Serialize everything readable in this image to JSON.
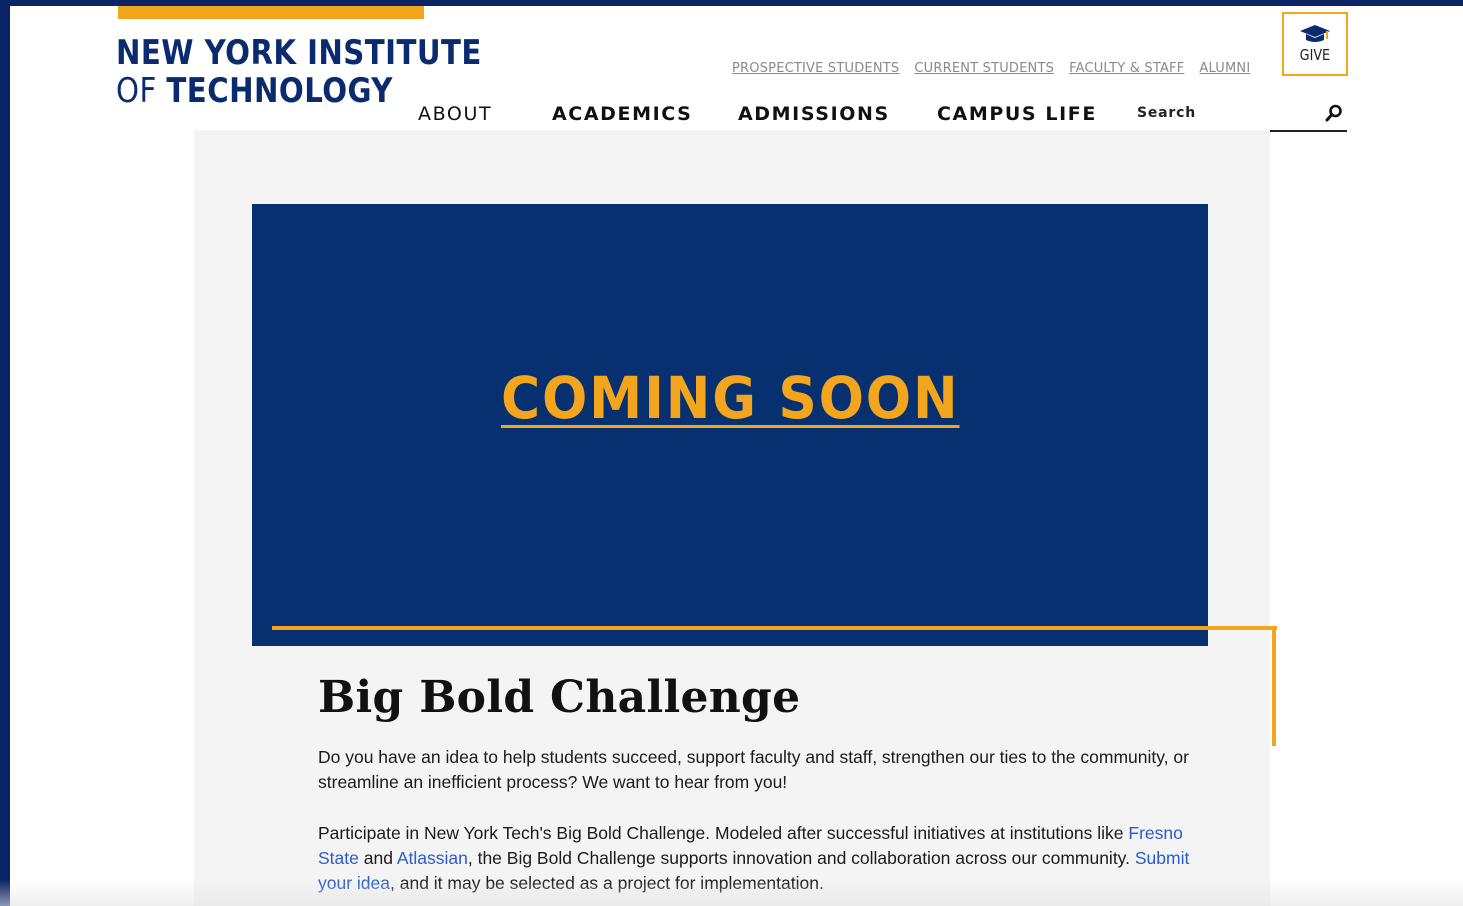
{
  "colors": {
    "navy": "#0b2b6f",
    "hero_blue": "#06306f",
    "gold": "#f3a51d",
    "link_blue": "#2a5ccb"
  },
  "logo": {
    "line1": "NEW YORK INSTITUTE",
    "line2_prefix": "OF ",
    "line2_bold": "TECHNOLOGY"
  },
  "utility_nav": [
    "PROSPECTIVE STUDENTS",
    "CURRENT STUDENTS",
    "FACULTY & STAFF",
    "ALUMNI"
  ],
  "give": {
    "label": "GIVE",
    "icon": "graduation-cap-icon"
  },
  "main_nav": [
    "ABOUT",
    "ACADEMICS",
    "ADMISSIONS",
    "CAMPUS LIFE"
  ],
  "search": {
    "placeholder": "Search",
    "icon": "search-icon"
  },
  "hero": {
    "text": "COMING SOON"
  },
  "article": {
    "title": "Big Bold Challenge",
    "p1": "Do you have an idea to help students succeed, support faculty and staff, strengthen our ties to the community, or streamline an inefficient process? We want to hear from you!",
    "p2": {
      "t1": "Participate in New York Tech's Big Bold Challenge. Modeled after successful initiatives at institutions like ",
      "link1": "Fresno State",
      "t2": " and ",
      "link2": "Atlassian",
      "t3": ", the Big Bold Challenge supports innovation and collaboration across our community. ",
      "link3": "Submit your idea",
      "t4": ", and it may be selected as a project for implementation."
    }
  }
}
